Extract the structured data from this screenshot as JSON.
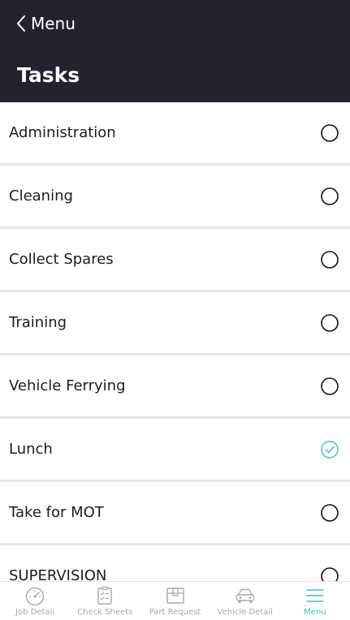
{
  "header": {
    "back_label": "Menu",
    "title": "Tasks",
    "background": "#23232f"
  },
  "tasks": [
    {
      "label": "Administration",
      "selected": false
    },
    {
      "label": "Cleaning",
      "selected": false
    },
    {
      "label": "Collect Spares",
      "selected": false
    },
    {
      "label": "Training",
      "selected": false
    },
    {
      "label": "Vehicle Ferrying",
      "selected": false
    },
    {
      "label": "Lunch",
      "selected": true
    },
    {
      "label": "Take for MOT",
      "selected": false
    },
    {
      "label": "SUPERVISION",
      "selected": false
    }
  ],
  "tabbar": {
    "active_color": "#3fc4b8",
    "inactive_color": "#a8a8a8",
    "tabs": [
      {
        "label": "Job Detail",
        "icon": "speedometer-icon",
        "active": false
      },
      {
        "label": "Check Sheets",
        "icon": "clipboard-checklist-icon",
        "active": false
      },
      {
        "label": "Part Request",
        "icon": "package-box-icon",
        "active": false
      },
      {
        "label": "Vehicle Detail",
        "icon": "car-icon",
        "active": false
      },
      {
        "label": "Menu",
        "icon": "hamburger-menu-icon",
        "active": true
      }
    ]
  }
}
